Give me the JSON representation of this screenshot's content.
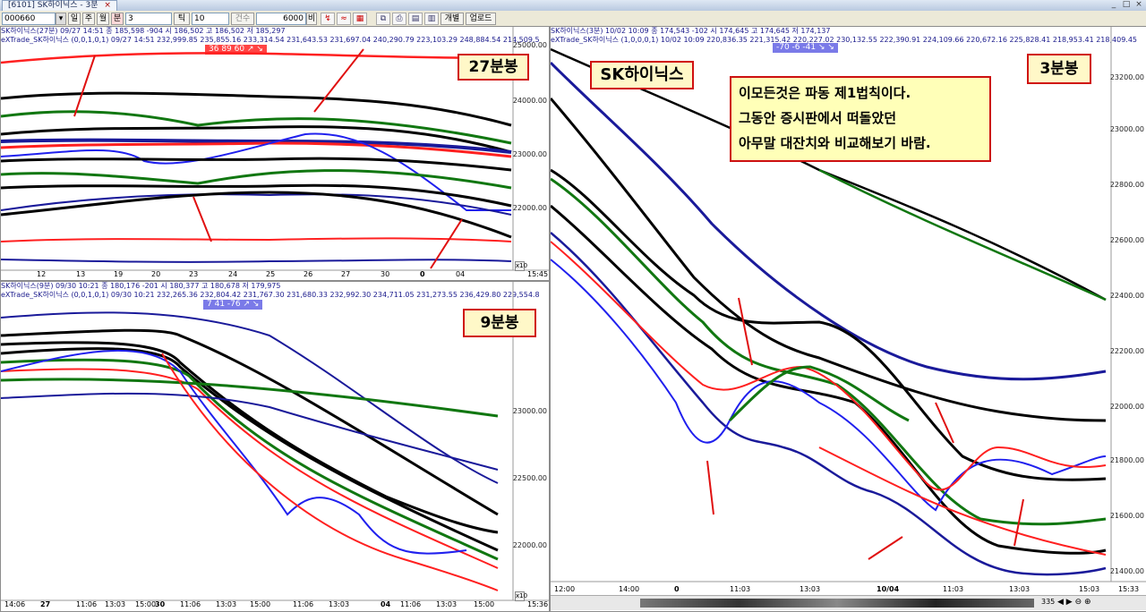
{
  "window": {
    "tab_title": "[6101] SK하이닉스 - 3분",
    "close_glyph": "×",
    "controls": [
      "_",
      "□",
      "×"
    ]
  },
  "toolbar": {
    "code": "000660",
    "period_buttons": [
      "일",
      "주",
      "월",
      "분",
      "틱"
    ],
    "minute_value": "3",
    "tick_value": "10",
    "count_label": "건수",
    "count_value": "6000",
    "count_unit": "비",
    "individual_label": "개별",
    "upload_label": "업로드",
    "icons": [
      "chart-icon",
      "line-icon",
      "table-icon",
      "copy-icon",
      "print-icon",
      "grid-icon",
      "doc-icon"
    ]
  },
  "panel_27": {
    "header1": "SK하이닉스(27분) 09/27 14:51  종 185,598 -904  시 186,502 고 186,502 저 185,297",
    "header2": "eXTrade_SK하이닉스 (0,0,1,0,1) 09/27 14:51 232,999.85 235,855.16 233,314.54 231,643.53 231,697.04 240,290.79 223,103.29 248,884.54 214,509.5",
    "overlay": "36  89  60  ↗ ↘",
    "period_label": "27분봉",
    "y_ticks": [
      "25000.00",
      "24000.00",
      "23000.00",
      "22000.00"
    ],
    "x_ticks": [
      "12",
      "13",
      "19",
      "20",
      "23",
      "24",
      "25",
      "26",
      "27",
      "30",
      "0",
      "04"
    ],
    "time": "15:45",
    "scale_mark": "x10"
  },
  "panel_9": {
    "header1": "SK하이닉스(9분) 09/30 10:21  종 180,176 -201  시 180,377 고 180,678 저 179,975",
    "header2": "eXTrade_SK하이닉스 (0,0,1,0,1) 09/30 10:21 232,265.36 232,804.42 231,767.30 231,680.33 232,992.30 234,711.05 231,273.55 236,429.80 229,554.8",
    "overlay": "7  41  -76  ↗ ↘",
    "period_label": "9분봉",
    "y_ticks": [
      "23000.00",
      "22500.00",
      "22000.00"
    ],
    "x_ticks": [
      "14:06",
      "27",
      "11:06",
      "13:03",
      "15:00",
      "30",
      "11:06",
      "13:03",
      "15:00",
      "11:06",
      "13:03",
      "04",
      "11:06",
      "13:03",
      "15:00"
    ],
    "time": "15:36",
    "scale_mark": "x10"
  },
  "panel_3": {
    "header1": "SK하이닉스(3분) 10/02 10:09  종 174,543 -102  시 174,645 고 174,645 저 174,137",
    "header2": "eXTrade_SK하이닉스 (1,0,0,0,1) 10/02 10:09 220,836.35 221,315.42 220,227.02 230,132.55 222,390.91 224,109.66 220,672.16 225,828.41 218,953.41 218,409.45",
    "overlay": "-70  -6  -41  ↘ ↘",
    "stock_label": "SK하이닉스",
    "period_label": "3분봉",
    "annotation_lines": [
      "이모든것은 파동 제1법칙이다.",
      "그동안 증시판에서 떠돌았던",
      "아무말 대잔치와 비교해보기 바람."
    ],
    "y_ticks": [
      "23200.00",
      "23000.00",
      "22800.00",
      "22600.00",
      "22400.00",
      "22200.00",
      "22000.00",
      "21800.00",
      "21600.00",
      "21400.00"
    ],
    "x_ticks": [
      "12:00",
      "14:00",
      "0",
      "11:03",
      "13:03",
      "10/04",
      "11:03",
      "13:03",
      "15:03"
    ],
    "time": "15:33",
    "zoom": "335"
  }
}
